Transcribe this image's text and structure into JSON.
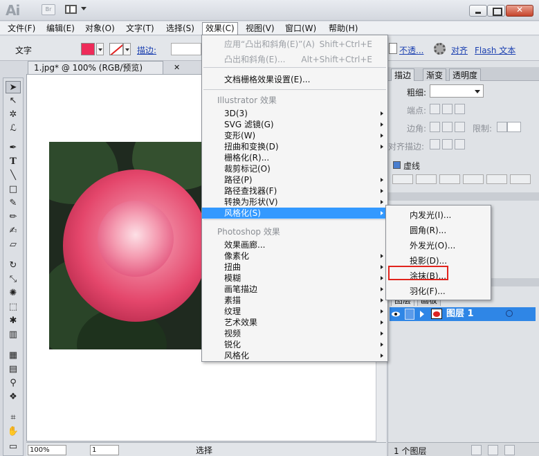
{
  "app": {
    "logo": "Ai",
    "bridge_label": "Br",
    "window_controls": [
      "minimize",
      "maximize",
      "close"
    ]
  },
  "menubar": {
    "items": [
      "文件(F)",
      "编辑(E)",
      "对象(O)",
      "文字(T)",
      "选择(S)",
      "效果(C)",
      "视图(V)",
      "窗口(W)",
      "帮助(H)"
    ]
  },
  "controlbar": {
    "type_label": "文字",
    "fill_color": "#ee2b59",
    "stroke_label": "描边:",
    "opacity_label": "不透...",
    "align_label": "对齐",
    "flash_label": "Flash 文本"
  },
  "document": {
    "tab_title": "1.jpg* @ 100% (RGB/预览)",
    "close_glyph": "✕"
  },
  "statusbar": {
    "zoom": "100%",
    "page": "1",
    "tool": "选择"
  },
  "effects_menu": {
    "items": [
      {
        "label": "应用“凸出和斜角(E)”(A)",
        "shortcut": "Shift+Ctrl+E",
        "disabled": true
      },
      {
        "label": "凸出和斜角(E)...",
        "shortcut": "Alt+Shift+Ctrl+E",
        "disabled": true
      },
      {
        "label": "文档栅格效果设置(E)..."
      },
      {
        "label": "Illustrator 效果",
        "heading": true
      },
      {
        "label": "3D(3)",
        "submenu": true
      },
      {
        "label": "SVG 滤镜(G)",
        "submenu": true
      },
      {
        "label": "变形(W)",
        "submenu": true
      },
      {
        "label": "扭曲和变换(D)",
        "submenu": true
      },
      {
        "label": "栅格化(R)..."
      },
      {
        "label": "裁剪标记(O)"
      },
      {
        "label": "路径(P)",
        "submenu": true
      },
      {
        "label": "路径查找器(F)",
        "submenu": true
      },
      {
        "label": "转换为形状(V)",
        "submenu": true
      },
      {
        "label": "风格化(S)",
        "submenu": true,
        "highlighted": true
      },
      {
        "label": "Photoshop 效果",
        "heading": true
      },
      {
        "label": "效果画廊..."
      },
      {
        "label": "像素化",
        "submenu": true
      },
      {
        "label": "扭曲",
        "submenu": true
      },
      {
        "label": "模糊",
        "submenu": true
      },
      {
        "label": "画笔描边",
        "submenu": true
      },
      {
        "label": "素描",
        "submenu": true
      },
      {
        "label": "纹理",
        "submenu": true
      },
      {
        "label": "艺术效果",
        "submenu": true
      },
      {
        "label": "视频",
        "submenu": true
      },
      {
        "label": "锐化",
        "submenu": true
      },
      {
        "label": "风格化",
        "submenu": true
      }
    ]
  },
  "stylize_menu": {
    "items": [
      "内发光(I)...",
      "圆角(R)...",
      "外发光(O)...",
      "投影(D)...",
      "涂抹(B)...",
      "羽化(F)..."
    ],
    "focused_index": 4
  },
  "stroke_panel": {
    "tabs": [
      "描边",
      "渐变",
      "透明度"
    ],
    "weight_label": "粗细:",
    "cap_label": "端点:",
    "corner_label": "边角:",
    "limit_label": "限制:",
    "align_label": "对齐描边:",
    "dashed_label": "虚线"
  },
  "layers_panel": {
    "tabs": [
      "图层",
      "画板"
    ],
    "layer_name": "图层 1",
    "count_label": "1 个图层"
  },
  "colors": {
    "menu_highlight": "#3399ff",
    "layer_selected": "#2f86e6",
    "callout": "#e1231c"
  }
}
